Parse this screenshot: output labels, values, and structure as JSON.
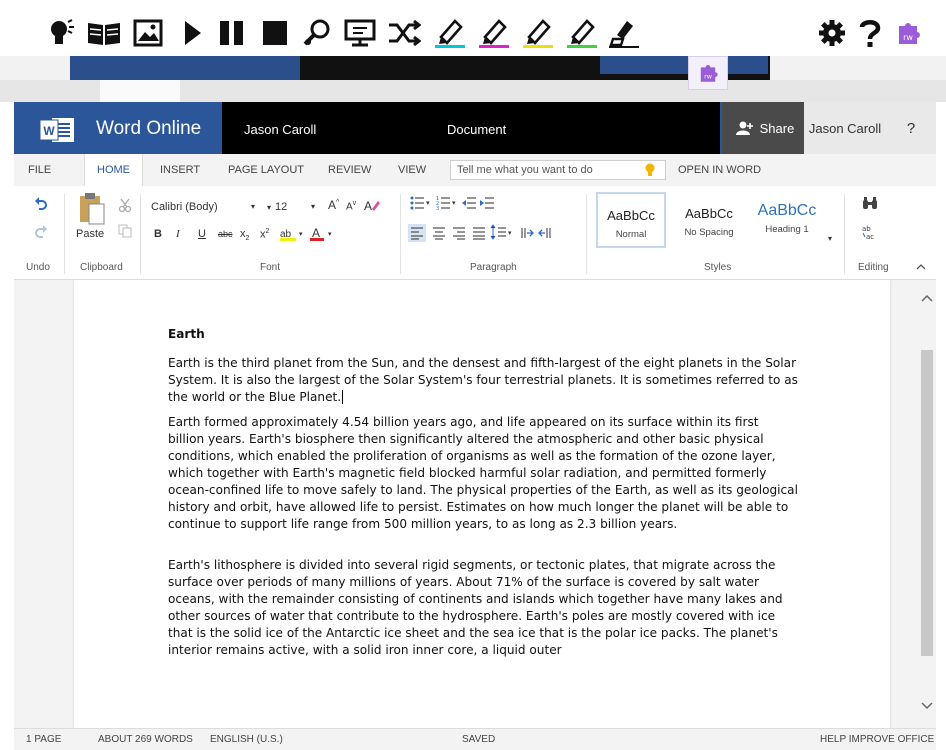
{
  "rw_toolbar": {
    "icons": [
      "talking-head-icon",
      "dictionary-icon",
      "picture-dictionary-icon",
      "play-icon",
      "pause-icon",
      "stop-icon",
      "screen-mask-icon",
      "voice-note-icon",
      "translator-icon",
      "highlight-cyan-icon",
      "highlight-magenta-icon",
      "highlight-yellow-icon",
      "highlight-green-icon",
      "clear-highlights-icon",
      "settings-icon",
      "help-icon",
      "rw-logo-icon"
    ],
    "highlight_colors": [
      "#00c8d8",
      "#e020c8",
      "#e8e010",
      "#40d040"
    ],
    "accent": "#9a5cd8"
  },
  "titlebar": {
    "app_name": "Word Online",
    "user_left": "Jason Caroll",
    "doc_title": "Document",
    "share_label": "Share",
    "user_right": "Jason Caroll",
    "help": "?",
    "brand_color": "#2b579a"
  },
  "tabs": {
    "items": [
      "FILE",
      "HOME",
      "INSERT",
      "PAGE LAYOUT",
      "REVIEW",
      "VIEW"
    ],
    "active": "HOME",
    "tell_me_placeholder": "Tell me what you want to do",
    "open_in_word": "OPEN IN WORD"
  },
  "ribbon": {
    "undo_group": "Undo",
    "clipboard_group": "Clipboard",
    "paste_label": "Paste",
    "font_group": "Font",
    "font_name": "Calibri (Body)",
    "font_size": "12",
    "paragraph_group": "Paragraph",
    "styles_group": "Styles",
    "styles": [
      {
        "sample": "AaBbCc",
        "name": "Normal"
      },
      {
        "sample": "AaBbCc",
        "name": "No Spacing"
      },
      {
        "sample": "AaBbCc",
        "name": "Heading 1"
      }
    ],
    "editing_group": "Editing",
    "font_buttons": {
      "bold": "B",
      "italic": "I",
      "underline": "U",
      "strike": "abc",
      "sub": "x",
      "sup": "x",
      "grow": "A",
      "shrink": "A",
      "color": "A"
    }
  },
  "document": {
    "heading": "Earth",
    "paragraphs": [
      "Earth is the third planet from the Sun, and the densest and fifth-largest of the eight planets in the Solar System. It is also the largest of the Solar System's four terrestrial planets. It is sometimes referred to as the world or the Blue Planet.",
      "Earth formed approximately 4.54 billion years ago, and life appeared on its surface within its first billion years. Earth's biosphere then significantly altered the atmospheric and other basic physical conditions, which enabled the proliferation of organisms as well as the formation of the ozone layer, which together with Earth's magnetic field blocked harmful solar radiation, and permitted formerly ocean-confined life to move safely to land. The physical properties of the Earth, as well as its geological history and orbit, have allowed life to persist. Estimates on how much longer the planet will be able to continue to support life range from 500 million years, to as long as 2.3 billion years.",
      "Earth's lithosphere is divided into several rigid segments, or tectonic plates, that migrate across the surface over periods of many millions of years. About 71% of the surface is covered by salt water oceans, with the remainder consisting of continents and islands which together have many lakes and other sources of water that contribute to the hydrosphere. Earth's poles are mostly covered with ice that is the solid ice of the Antarctic ice sheet and the sea ice that is the polar ice packs. The planet's interior remains active, with a solid iron inner core, a liquid outer"
    ]
  },
  "statusbar": {
    "pages": "1 PAGE",
    "words": "ABOUT 269 WORDS",
    "language": "ENGLISH (U.S.)",
    "save_state": "SAVED",
    "feedback": "HELP IMPROVE OFFICE"
  }
}
